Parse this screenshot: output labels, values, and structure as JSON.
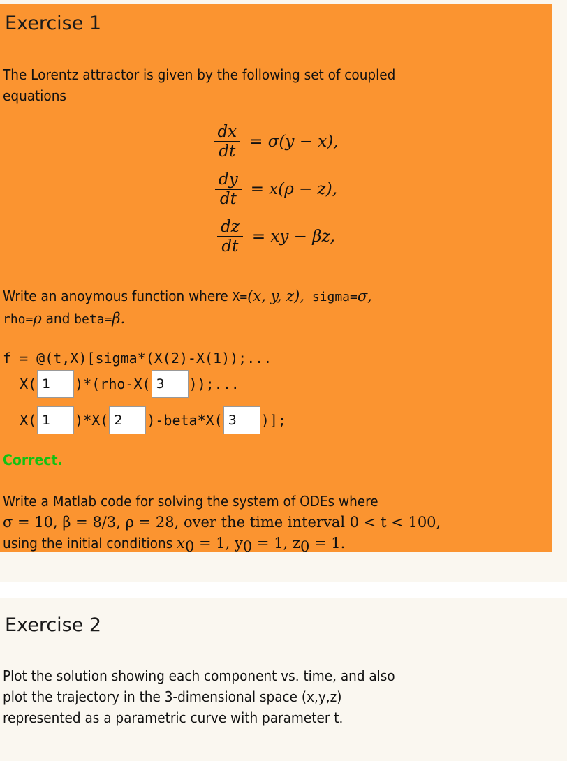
{
  "colors": {
    "panel_orange": "#FB9430",
    "page_cream": "#FAF7F0",
    "separator_white": "#FFFFFF",
    "correct_green": "#12C212",
    "text_black": "#111111",
    "input_border": "#999999",
    "input_background": "#FFFFFF"
  },
  "exercise1": {
    "heading": "Exercise 1",
    "intro_line1": "The Lorentz attractor is given by the following set of coupled",
    "intro_line2": "equations",
    "equations": [
      {
        "num": "dx",
        "den": "dt",
        "rhs": "= σ(y − x),"
      },
      {
        "num": "dy",
        "den": "dt",
        "rhs": "= x(ρ − z),"
      },
      {
        "num": "dz",
        "den": "dt",
        "rhs": "= xy − βz,"
      }
    ],
    "anon": {
      "l1_a": "Write an anoymous function where ",
      "l1_mono1": "X=",
      "l1_math1": "(x, y, z),",
      "l1_mono2": " sigma=",
      "l1_math2": "σ,",
      "l2_mono1": "rho=",
      "l2_math1": "ρ",
      "l2_b": " and ",
      "l2_mono2": "beta=",
      "l2_math2": "β."
    },
    "code": {
      "line1": "f = @(t,X)[sigma*(X(2)-X(1));...",
      "line2_pre": "  X(",
      "line2_mid": ")*(rho-X(",
      "line2_post": "));...",
      "line3_pre": "  X(",
      "line3_mid1": ")*X(",
      "line3_mid2": ")-beta*X(",
      "line3_post": ")];",
      "inputs": {
        "box1": "1",
        "box2": "3",
        "box3": "1",
        "box4": "2",
        "box5": "3"
      },
      "input_placeholder": ""
    },
    "feedback": "Correct.",
    "task": {
      "line1": "Write a Matlab code for solving the system of ODEs where",
      "line2_a": "σ = 10, β = 8/3, ρ = 28, over the time interval ",
      "line2_b": "0 < t < 100,",
      "line3_a": "using the initial conditions ",
      "line3_b": "x",
      "line3_sub1": "0",
      "line3_c": " = 1, y",
      "line3_sub2": "0",
      "line3_d": " = 1, z",
      "line3_sub3": "0",
      "line3_e": " = 1."
    }
  },
  "exercise2": {
    "heading": "Exercise 2",
    "body_line1": "Plot the solution showing each component vs. time, and also",
    "body_line2": "plot the trajectory in the 3-dimensional space (x,y,z)",
    "body_line3": "represented as a parametric curve with parameter t."
  }
}
